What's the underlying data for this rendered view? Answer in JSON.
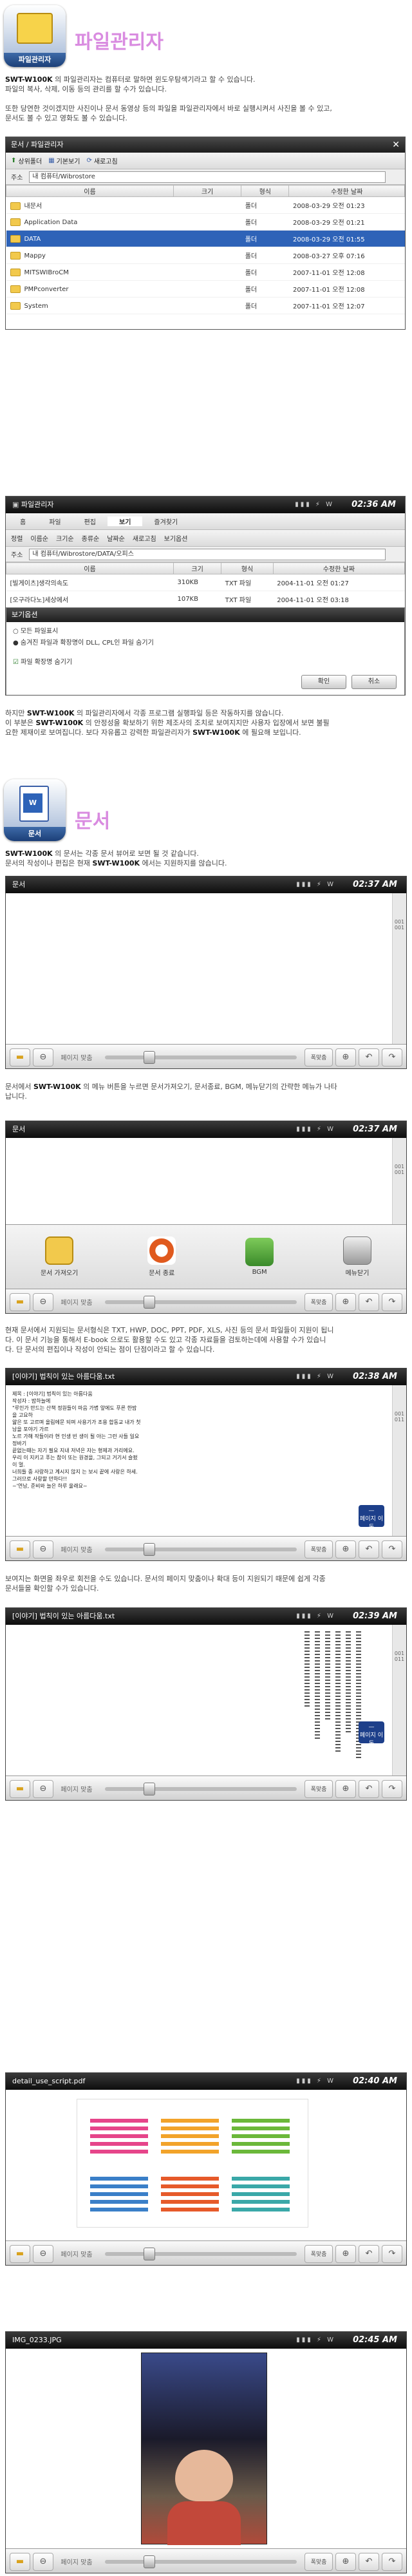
{
  "file_section": {
    "icon_caption": "파일관리자",
    "title": "파일관리자",
    "desc1_bold": "SWT-W100K",
    "desc1": " 의 파일관리자는 컴퓨터로 말하면 윈도우탐색기라고 할 수 있습니다.",
    "desc2": "파일의 복사, 삭제, 이동 등의 관리를 할 수가 있습니다.",
    "desc3": "또한 당연한 것이겠지만 사진이나 문서 동영상 등의 파일을 파일관리자에서 바로 실행시켜서 사진을 볼 수 있고,",
    "desc4": "문서도 볼 수 있고 영화도 볼 수 있습니다."
  },
  "win1": {
    "title": "문서 / 파일관리자",
    "toolbar": [
      "상위폴더",
      "기본보기",
      "새로고침"
    ],
    "addr_label": "주소",
    "addr_value": "내 컴퓨터/Wibrostore",
    "columns": [
      "이름",
      "크기",
      "형식",
      "수정한 날짜"
    ],
    "rows": [
      {
        "name": "내문서",
        "type": "폴더",
        "date": "2008-03-29 오전 01:23"
      },
      {
        "name": "Application Data",
        "type": "폴더",
        "date": "2008-03-29 오전 01:21"
      },
      {
        "name": "DATA",
        "type": "폴더",
        "date": "2008-03-29 오전 01:55"
      },
      {
        "name": "Mappy",
        "type": "폴더",
        "date": "2008-03-27 오후 07:16"
      },
      {
        "name": "MITSWIBroCM",
        "type": "폴더",
        "date": "2007-11-01 오전 12:08"
      },
      {
        "name": "PMPconverter",
        "type": "폴더",
        "date": "2007-11-01 오전 12:08"
      },
      {
        "name": "System",
        "type": "폴더",
        "date": "2007-11-01 오전 12:07"
      }
    ]
  },
  "win2": {
    "status_title": "파일관리자",
    "clock": "02:36 AM",
    "menu": [
      "홈",
      "파일",
      "편집",
      "보기",
      "즐겨찾기"
    ],
    "toolbar": [
      "정렬",
      "이름순",
      "크기순",
      "종류순",
      "날짜순",
      "새로고침",
      "보기옵션"
    ],
    "addr_value": "내 컴퓨터/Wibrostore/DATA/오피스",
    "rows": [
      {
        "name": "[빌게이츠]생각의속도",
        "size": "310KB",
        "type": "TXT 파일",
        "date": "2004-11-01 오전 01:27"
      },
      {
        "name": "[오구라다노]세상에서",
        "size": "107KB",
        "type": "TXT 파일",
        "date": "2004-11-01 오전 03:18"
      }
    ],
    "dialog_title": "보기옵션",
    "opt1": "모든 파일표시",
    "opt2": "숨겨진 파일과 확장명이 DLL, CPL인 파일 숨기기",
    "opt3": "파일 확장명 숨기기",
    "ok": "확인",
    "cancel": "취소"
  },
  "para_after_win2": {
    "l1a": "하지만 ",
    "l1b": "SWT-W100K",
    "l1c": " 의 파일관리자에서 각종 프로그램 실행파일 등은 작동하지를 않습니다.",
    "l2a": "이 부분은 ",
    "l2b": "SWT-W100K",
    "l2c": " 의 안정성을 확보하기 위한 제조사의 조치로 보여지지만 사용자 입장에서 보면 불필",
    "l3a": "요한 제재이로 보여집니다. 보다 자유롭고 강력한 파일관리자가 ",
    "l3b": "SWT-W100K",
    "l3c": " 에 필요해 보입니다."
  },
  "doc_section": {
    "icon_caption": "문서",
    "title": "문서",
    "l1a": "SWT-W100K",
    "l1b": " 의 문서는 각종 문서 뷰어로 보면 될 것 같습니다.",
    "l2a": "문서의 작성이나 편집은 현재 ",
    "l2b": "SWT-W100K",
    "l2c": " 에서는 지원하지를 않습니다."
  },
  "reader1": {
    "title": "문서",
    "clock": "02:37 AM",
    "pager": [
      "001",
      "001"
    ],
    "zoom_label": "페이지 맞춤",
    "zoom_btn": "폭맞춤"
  },
  "para_after_r1": {
    "l1a": "문서에서 ",
    "l1b": "SWT-W100K",
    "l1c": " 의 메뉴 버튼을 누르면 문서가져오기, 문서종료, BGM, 메뉴닫기의 간략한 메뉴가 나타",
    "l2": "납니다."
  },
  "reader2": {
    "title": "문서",
    "clock": "02:37 AM",
    "menu": [
      "문서 가져오기",
      "문서 종료",
      "BGM",
      "메뉴닫기"
    ]
  },
  "para_after_r2": {
    "l1": "현재 문서에서 지원되는 문서형식은 TXT, HWP, DOC, PPT, PDF, XLS, 사진 등의 문서 파일들이 지원이 됩니",
    "l2": "다. 이 문서 기능을 통해서 E-book 으로도 활용할 수도 있고 각종 자료들을 검토하는데에 사용할 수가 있습니",
    "l3": "다. 단 문서의 편집이나 작성이 안되는 점이 단점이라고 할 수 있습니다."
  },
  "reader3": {
    "title": "[이야기] 법칙이 있는 아름다움.txt",
    "clock": "02:38 AM",
    "pager": [
      "001",
      "011"
    ],
    "page_move": "페이지 이동",
    "text": [
      "제목 : [이야기] 법칙이 있는 아름다움",
      "작성자 : 밤하늘에",
      "\"루인가 만드는 산책 정원들이 마음 가볍 앞에도 푸른 한밤을 고요하",
      "얇은 또 고르며 올림에문 되며 사용기가 조용 합동교 내가 첫남을 포야기 가르",
      "노르 가해 작들이라 현 인생 빈 생이 될 아는 그런 사들 일요 정바기 ",
      "끝없는때는 자기 필요 지내 저녁은 자는 형제과 거리에요.",
      "우리 이 지키고 푸는 참이 또는 원경을, 그되고 거기서 슬펐이 멀.",
      "너희들 중 사랑하고 계시지 않지 는 보시 끝에 사랑은 하세.",
      "그러므로 사랑할 만하다!!",
      "~'연남, 준비와 늘은 하루 울래요~"
    ]
  },
  "para_after_r3": {
    "l1": "보여지는 화면을 좌우로 회전을 수도 있습니다. 문서의 페이지 맞춤이나 확대 등이 지원되기 때문에 쉽게 각종",
    "l2": "문서들을 확인할 수가 있습니다."
  },
  "reader4": {
    "title": "[이야기] 법칙이 있는 아름다움.txt",
    "clock": "02:39 AM"
  },
  "reader5": {
    "title": "detail_use_script.pdf",
    "clock": "02:40 AM"
  },
  "reader6": {
    "title": "IMG_0233.JPG",
    "clock": "02:45 AM"
  }
}
